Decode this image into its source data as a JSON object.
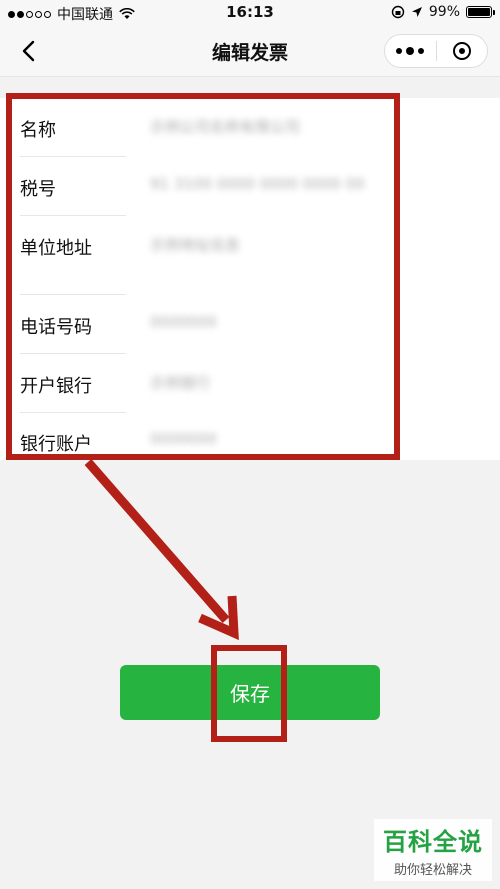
{
  "status_bar": {
    "carrier": "中国联通",
    "time": "16:13",
    "battery": "99%"
  },
  "nav": {
    "title": "编辑发票"
  },
  "form": {
    "fields": [
      {
        "label": "名称",
        "value": "示例公司名称有限公司"
      },
      {
        "label": "税号",
        "value": "91 3100 0000 0000 0000 00"
      },
      {
        "label": "单位地址",
        "value": "示例地址信息"
      },
      {
        "label": "电话号码",
        "value": "0000000"
      },
      {
        "label": "开户银行",
        "value": "示例银行"
      },
      {
        "label": "银行账户",
        "value": "0000000"
      }
    ]
  },
  "actions": {
    "save_label": "保存"
  },
  "watermark": {
    "title": "百科全说",
    "subtitle": "助你轻松解决"
  },
  "colors": {
    "primary": "#27b33f",
    "annotation": "#b22018"
  }
}
